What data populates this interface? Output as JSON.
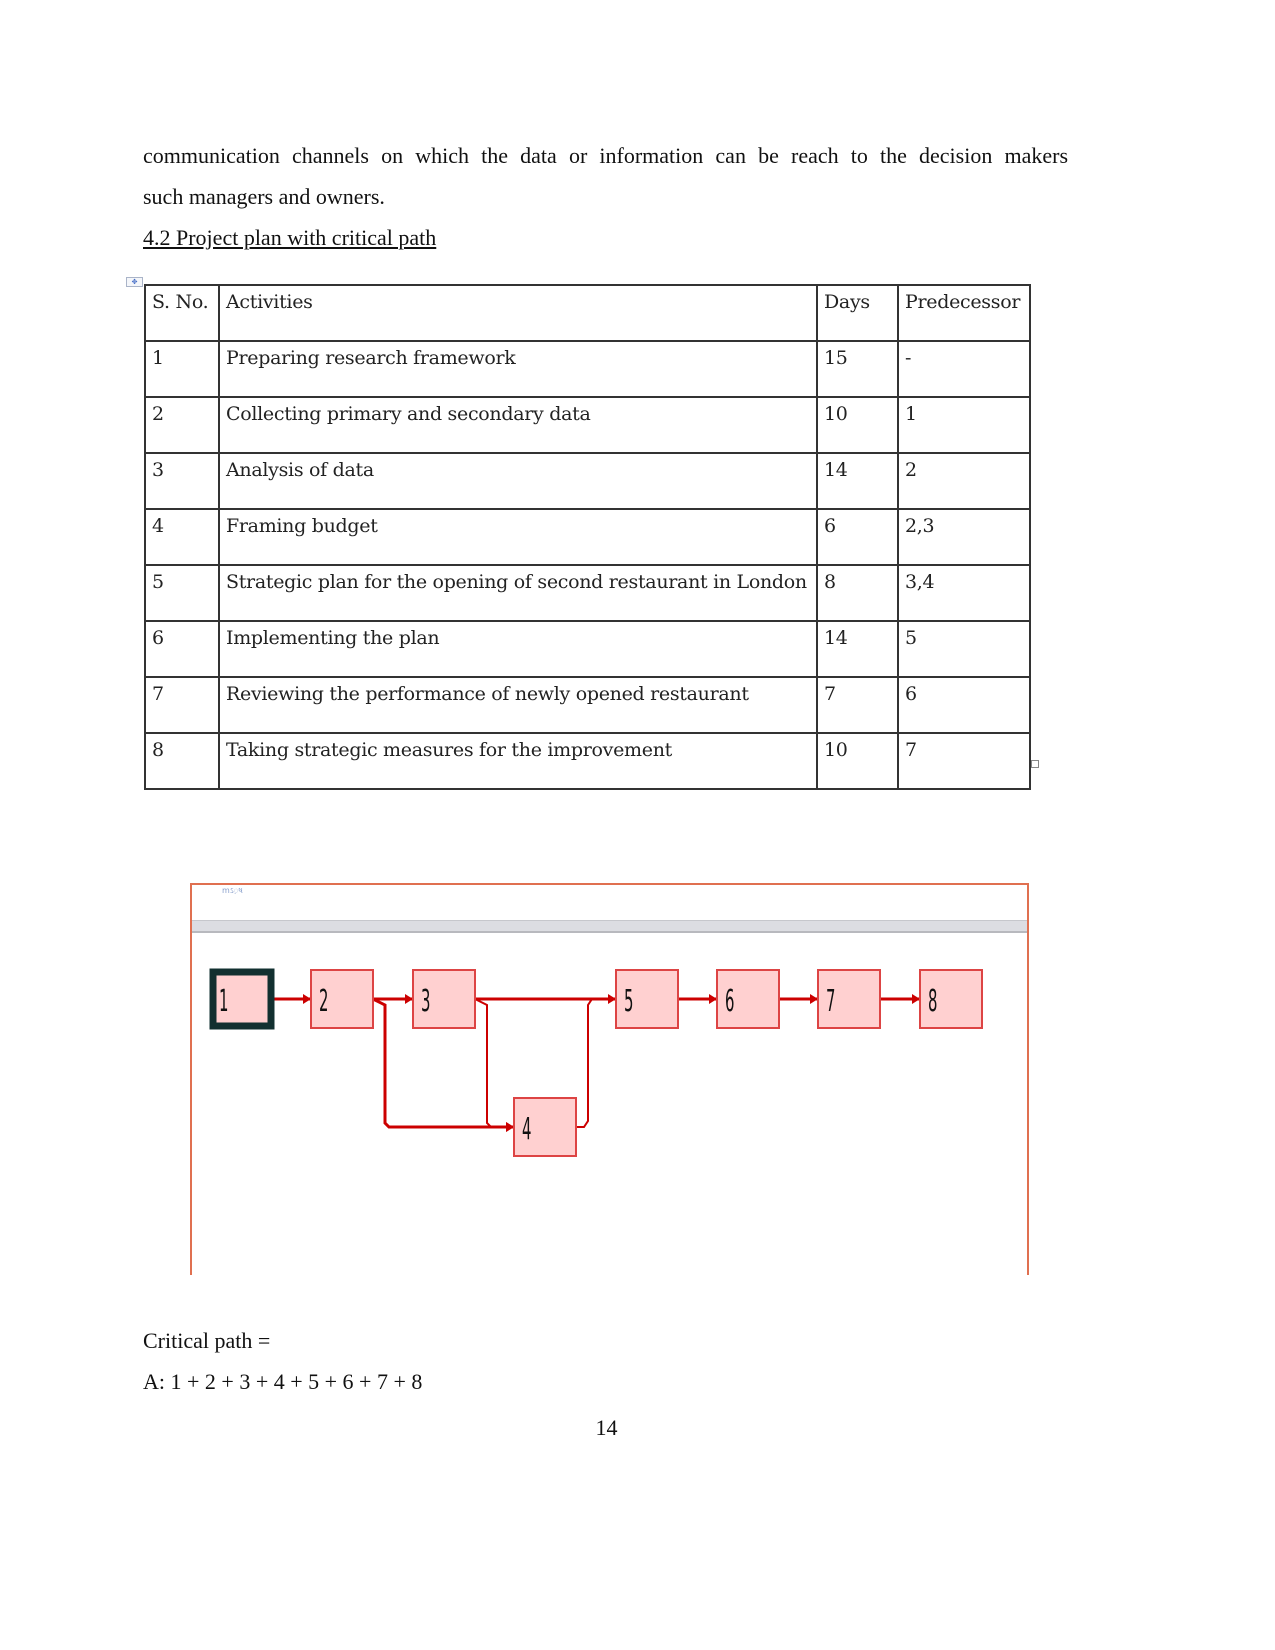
{
  "body": {
    "paragraph_line1": "communication channels on which the data or information can be reach to the decision makers",
    "paragraph_line2": "such managers and owners.",
    "section_heading": "4.2 Project plan with critical path"
  },
  "table": {
    "headers": [
      "S. No.",
      "Activities",
      "Days",
      "Predecessor"
    ],
    "rows": [
      {
        "sno": "1",
        "activity": "Preparing research  framework",
        "days": "15",
        "predecessor": "-"
      },
      {
        "sno": "2",
        "activity": "Collecting primary and secondary data",
        "days": "10",
        "predecessor": "1"
      },
      {
        "sno": "3",
        "activity": "Analysis of data",
        "days": "14",
        "predecessor": "2"
      },
      {
        "sno": "4",
        "activity": "Framing budget",
        "days": "6",
        "predecessor": "2,3"
      },
      {
        "sno": "5",
        "activity": "Strategic plan for the opening of second restaurant in London",
        "days": "8",
        "predecessor": "3,4"
      },
      {
        "sno": "6",
        "activity": "Implementing the plan",
        "days": "14",
        "predecessor": "5"
      },
      {
        "sno": "7",
        "activity": "Reviewing the performance of newly opened restaurant",
        "days": "7",
        "predecessor": "6"
      },
      {
        "sno": "8",
        "activity": "Taking strategic measures  for the improvement",
        "days": "10",
        "predecessor": "7"
      }
    ]
  },
  "network_diagram": {
    "caption": "mઽ़ષ",
    "colors": {
      "node_fill": "#ffd0d0",
      "node_border": "#dd4444",
      "edge": "#cc0000",
      "selected_border": "#123030",
      "frame": "#e07050"
    },
    "nodes": [
      {
        "id": "1",
        "selected": true
      },
      {
        "id": "2"
      },
      {
        "id": "3"
      },
      {
        "id": "4"
      },
      {
        "id": "5"
      },
      {
        "id": "6"
      },
      {
        "id": "7"
      },
      {
        "id": "8"
      }
    ],
    "edges": [
      [
        "1",
        "2"
      ],
      [
        "2",
        "3"
      ],
      [
        "3",
        "5"
      ],
      [
        "2",
        "4"
      ],
      [
        "3",
        "4"
      ],
      [
        "4",
        "5"
      ],
      [
        "5",
        "6"
      ],
      [
        "6",
        "7"
      ],
      [
        "7",
        "8"
      ]
    ]
  },
  "critical_path": {
    "label": "Critical path =",
    "value": "A: 1 + 2 + 3 + 4 + 5 + 6 + 7 + 8"
  },
  "page_number": "14"
}
